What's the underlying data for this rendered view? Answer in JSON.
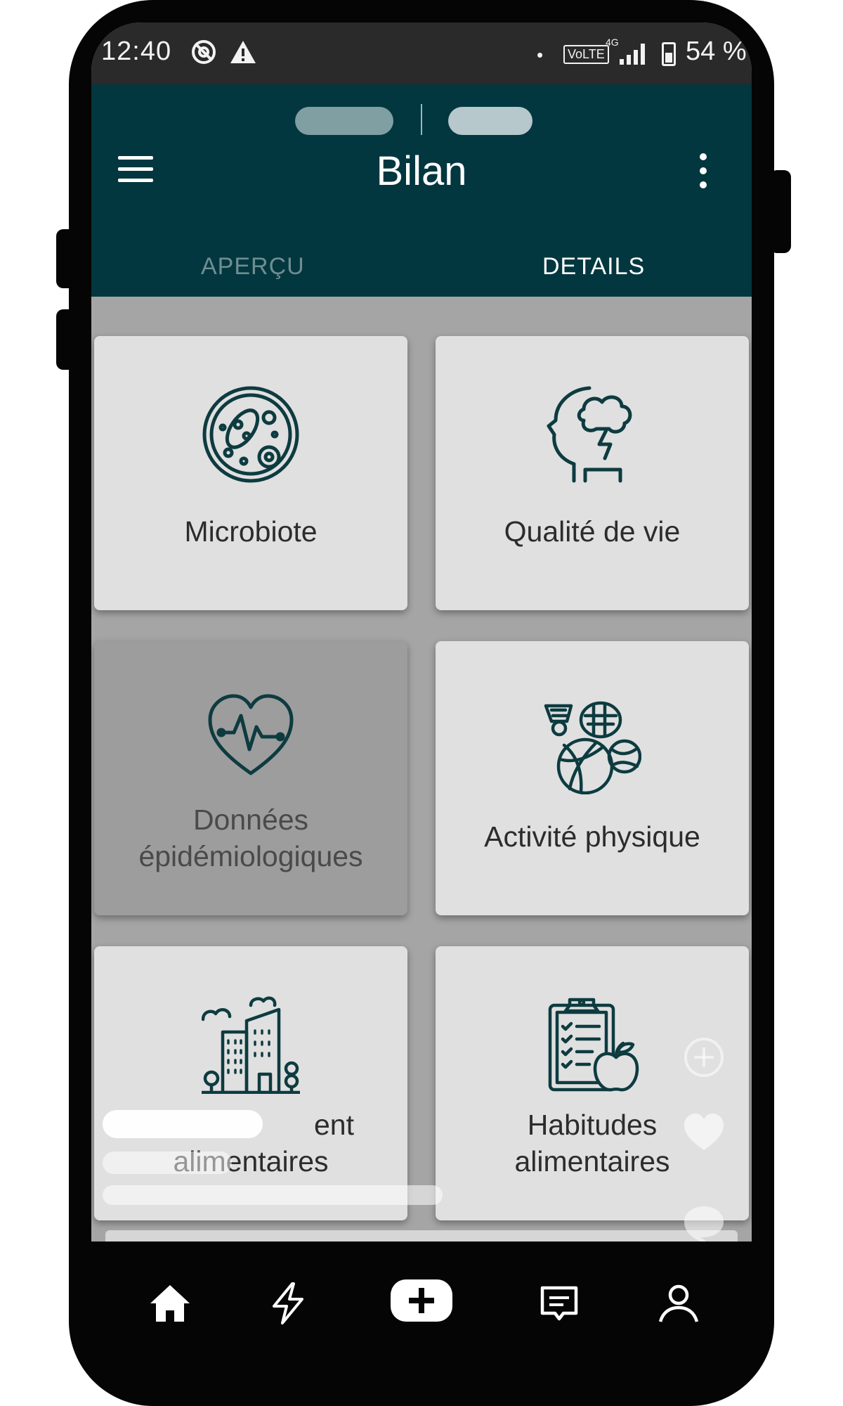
{
  "status_bar": {
    "time": "12:40",
    "network_badge": "VoLTE",
    "network_type": "4G",
    "battery": "54 %"
  },
  "app_bar": {
    "title": "Bilan",
    "tabs": [
      {
        "label": "APERÇU",
        "selected": false
      },
      {
        "label": "DETAILS",
        "selected": true
      }
    ]
  },
  "cards": [
    {
      "label_line1": "Microbiote",
      "label_line2": "",
      "icon": "microbiome-icon"
    },
    {
      "label_line1": "Qualité de vie",
      "label_line2": "",
      "icon": "head-cloud-icon"
    },
    {
      "label_line1": "Données",
      "label_line2": "épidémiologiques",
      "icon": "heart-pulse-icon"
    },
    {
      "label_line1": "Activité physique",
      "label_line2": "",
      "icon": "sports-balls-icon"
    },
    {
      "label_line1": "ent",
      "label_line2": "alimentaires",
      "icon": "city-buildings-icon"
    },
    {
      "label_line1": "Habitudes",
      "label_line2": "alimentaires",
      "icon": "clipboard-apple-icon"
    }
  ],
  "colors": {
    "app_bar": "#02373f",
    "icon_stroke": "#0d3b40",
    "card": "#e0e0e0",
    "content_bg": "#a5a5a5"
  },
  "bottom_nav": [
    "home-icon",
    "lightning-icon",
    "add-icon",
    "message-icon",
    "profile-icon"
  ]
}
